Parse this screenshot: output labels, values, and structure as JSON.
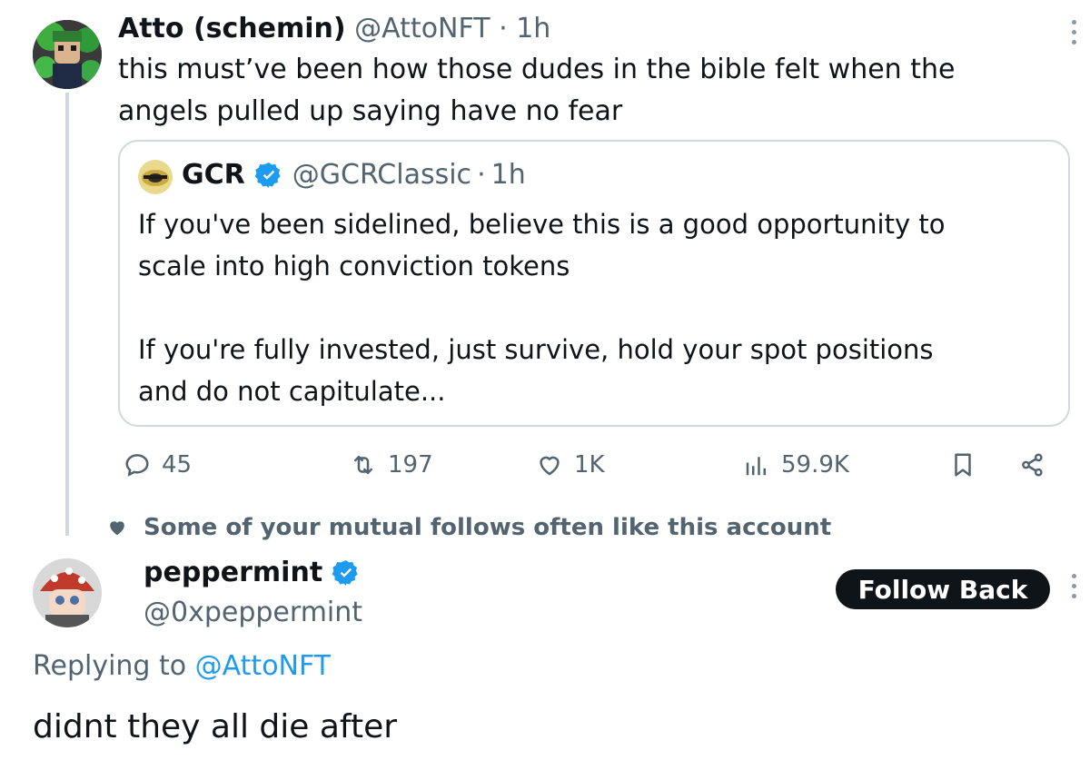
{
  "main_tweet": {
    "author_name": "Atto (schemin)",
    "author_handle": "@AttoNFT",
    "separator": "·",
    "time": "1h",
    "text": "this must’ve been how those dudes in the bible felt when the\nangels pulled up saying have no fear"
  },
  "quote_tweet": {
    "author_name": "GCR",
    "author_handle": "@GCRClassic",
    "separator": "·",
    "time": "1h",
    "text": "If you've been sidelined, believe this is a good opportunity to\nscale into high conviction tokens\n\nIf you're fully invested, just survive, hold your spot positions\nand do not capitulate..."
  },
  "actions": {
    "replies": "45",
    "retweets": "197",
    "likes": "1K",
    "views": "59.9K"
  },
  "social_context": {
    "text": "Some of your mutual follows often like this account"
  },
  "reply": {
    "author_name": "peppermint",
    "author_handle": "@0xpeppermint",
    "follow_label": "Follow Back",
    "replying_prefix": "Replying to ",
    "replying_to": "@AttoNFT",
    "text": "didnt they all die after"
  },
  "colors": {
    "verified_blue": "#1d9bf0",
    "muted_text": "#536471",
    "link": "#1d9bf0",
    "button_bg": "#0f1419"
  },
  "icons": {
    "reply": "speech-bubble-icon",
    "retweet": "retweet-icon",
    "like": "heart-icon",
    "views": "bar-chart-icon",
    "bookmark": "bookmark-icon",
    "share": "share-icon",
    "more": "vertical-dots-icon",
    "verified": "verified-badge-icon"
  }
}
